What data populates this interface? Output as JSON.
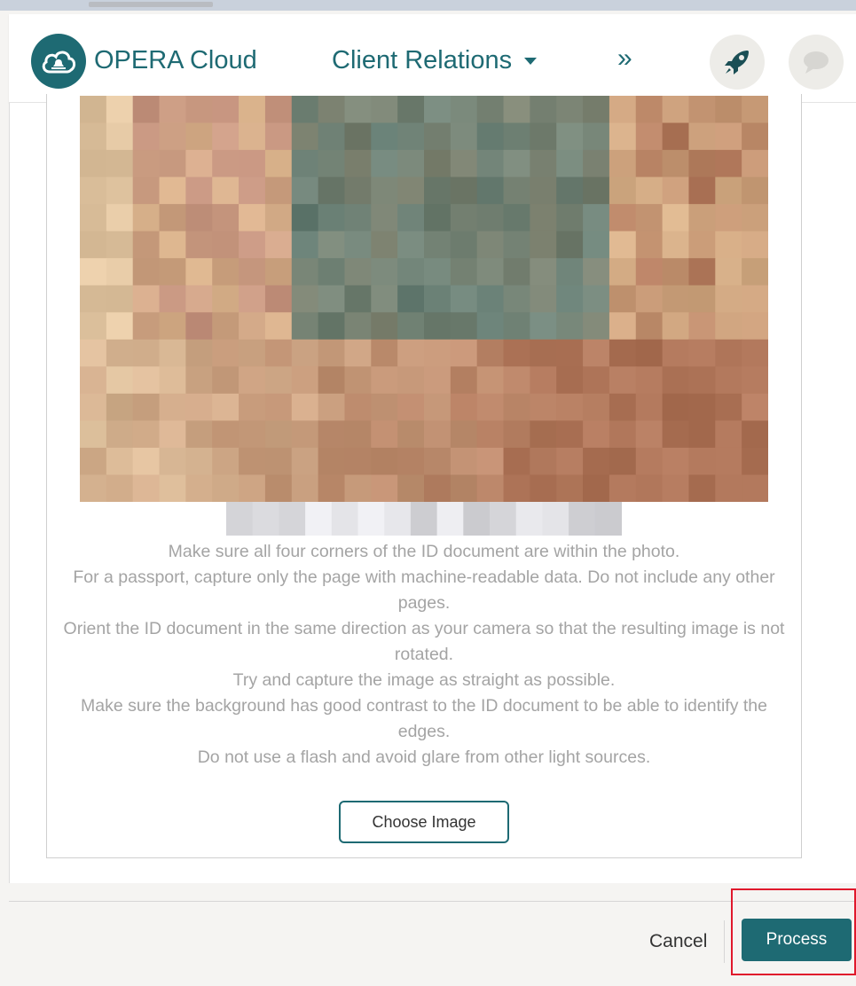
{
  "header": {
    "brand": "OPERA Cloud",
    "menu_label": "Client Relations",
    "more_label": "»",
    "logo_icon": "cloud-bell-icon",
    "rocket_icon": "rocket-icon",
    "chat_icon": "chat-bubble-icon"
  },
  "dialog": {
    "instructions": [
      "Make sure all four corners of the ID document are within the photo.",
      "For a passport, capture only the page with machine-readable data. Do not include any other pages.",
      "Orient the ID document in the same direction as your camera so that the resulting image is not rotated.",
      "Try and capture the image as straight as possible.",
      "Make sure the background has good contrast to the ID document to be able to identify the edges.",
      "Do not use a flash and avoid glare from other light sources."
    ],
    "choose_image_label": "Choose Image"
  },
  "footer": {
    "cancel_label": "Cancel",
    "process_label": "Process"
  },
  "colors": {
    "accent": "#1e6a73",
    "highlight": "#e0182c"
  }
}
